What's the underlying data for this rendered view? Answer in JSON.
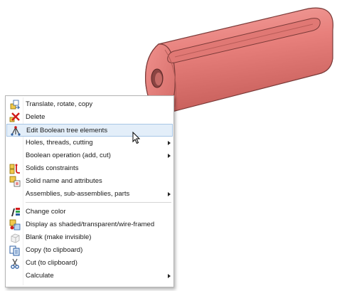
{
  "context_menu": {
    "items": [
      {
        "label": "Translate, rotate, copy",
        "icon": "translate-rotate-copy-icon",
        "submenu": false
      },
      {
        "label": "Delete",
        "icon": "delete-icon",
        "submenu": false
      },
      {
        "label": "Edit Boolean tree elements",
        "icon": "boolean-tree-icon",
        "submenu": false,
        "highlighted": true
      },
      {
        "label": "Holes, threads, cutting",
        "icon": "",
        "submenu": true
      },
      {
        "label": "Boolean operation (add, cut)",
        "icon": "",
        "submenu": true
      },
      {
        "label": "Solids constraints",
        "icon": "solids-constraints-icon",
        "submenu": false
      },
      {
        "label": "Solid name and attributes",
        "icon": "solid-attributes-icon",
        "submenu": false
      },
      {
        "label": "Assemblies, sub-assemblies, parts",
        "icon": "",
        "submenu": true
      },
      {
        "label": "Change color",
        "icon": "change-color-icon",
        "submenu": false
      },
      {
        "label": "Display as shaded/transparent/wire-framed",
        "icon": "display-mode-icon",
        "submenu": false
      },
      {
        "label": "Blank (make invisible)",
        "icon": "blank-icon",
        "submenu": false
      },
      {
        "label": "Copy (to clipboard)",
        "icon": "copy-icon",
        "submenu": false
      },
      {
        "label": "Cut (to clipboard)",
        "icon": "cut-icon",
        "submenu": false
      },
      {
        "label": "Calculate",
        "icon": "",
        "submenu": true
      }
    ]
  },
  "colors": {
    "solid_face": "#e8807c",
    "solid_edge": "#7a3a38",
    "menu_highlight": "#e3eef9"
  }
}
